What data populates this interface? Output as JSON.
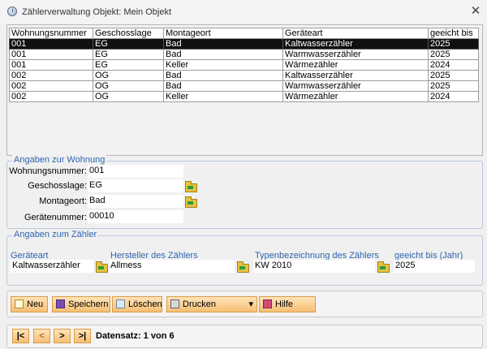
{
  "window": {
    "title": "Zählerverwaltung  Objekt: Mein Objekt",
    "close": "✕"
  },
  "grid": {
    "columns": [
      "Wohnungsnummer",
      "Geschosslage",
      "Montageort",
      "Geräteart",
      "geeicht bis"
    ],
    "rows": [
      [
        "001",
        "EG",
        "Bad",
        "Kaltwasserzähler",
        "2025"
      ],
      [
        "001",
        "EG",
        "Bad",
        "Warmwasserzähler",
        "2025"
      ],
      [
        "001",
        "EG",
        "Keller",
        "Wärmezähler",
        "2024"
      ],
      [
        "002",
        "OG",
        "Bad",
        "Kaltwasserzähler",
        "2025"
      ],
      [
        "002",
        "OG",
        "Bad",
        "Warmwasserzähler",
        "2025"
      ],
      [
        "002",
        "OG",
        "Keller",
        "Wärmezähler",
        "2024"
      ]
    ],
    "selected_row": 0
  },
  "wohnung": {
    "legend": "Angaben zur Wohnung",
    "wohnungsnummer_label": "Wohnungsnummer:",
    "wohnungsnummer": "001",
    "geschosslage_label": "Geschosslage:",
    "geschosslage": "EG",
    "montageort_label": "Montageort:",
    "montageort": "Bad",
    "geraetenummer_label": "Gerätenummer:",
    "geraetenummer": "00010"
  },
  "zaehler": {
    "legend": "Angaben zum Zähler",
    "geraeteart_label": "Geräteart",
    "geraeteart": "Kaltwasserzähler",
    "hersteller_label": "Hersteller des Zählers",
    "hersteller": "Allmess",
    "typ_label": "Typenbezeichnung des Zählers",
    "typ": "KW 2010",
    "geeicht_label": "geeicht bis (Jahr)",
    "geeicht": "2025"
  },
  "toolbar": {
    "neu": "Neu",
    "speichern": "Speichern",
    "loeschen": "Löschen",
    "drucken": "Drucken",
    "drucken_arrow": "▾",
    "hilfe": "Hilfe"
  },
  "navigation": {
    "first": "|<",
    "prev": "<",
    "next": ">",
    "last": ">|",
    "status": "Datensatz: 1 von 6"
  },
  "colors": {
    "accent_blue": "#2e64b0",
    "button_orange": "#f6bf74",
    "selected_row": "#111111"
  }
}
